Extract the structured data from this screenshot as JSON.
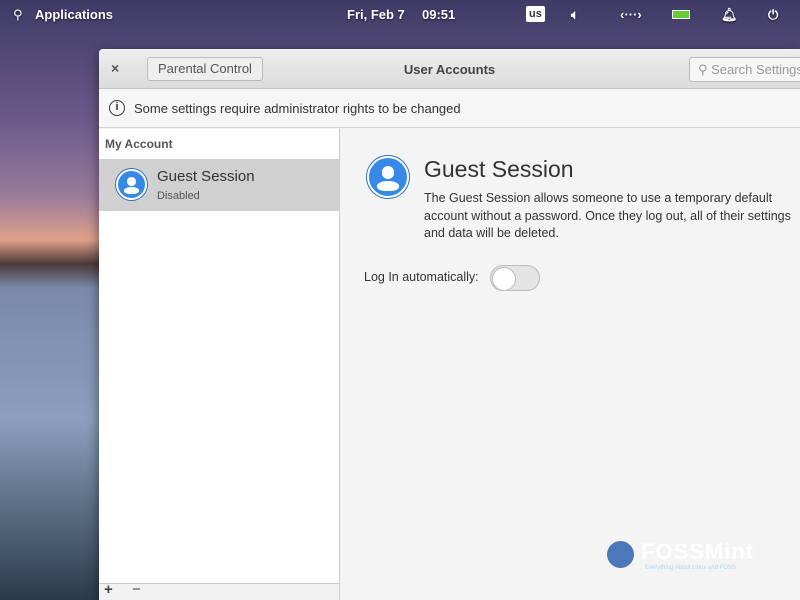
{
  "panel": {
    "applications": "Applications",
    "date": "Fri, Feb  7",
    "time": "09:51",
    "keyboard": "us",
    "icons": [
      "search-icon",
      "volume-icon",
      "network-icon",
      "battery-icon",
      "notification-bell-icon",
      "power-icon"
    ]
  },
  "window": {
    "title": "User Accounts",
    "back_label": "Parental Control",
    "search_placeholder": "Search Settings",
    "info": "Some settings require administrator rights to be changed"
  },
  "sidebar": {
    "section": "My Account",
    "items": [
      {
        "name": "Guest Session",
        "status": "Disabled"
      }
    ],
    "add": "+",
    "remove": "−"
  },
  "main": {
    "title": "Guest Session",
    "description": "The Guest Session allows someone to use a temporary default account without a password. Once they log out, all of their settings and data will be deleted.",
    "autologin_label": "Log In automatically:",
    "autologin_on": false
  },
  "watermark": {
    "name": "FOSSMint",
    "tagline": "Everything About Linux and FOSS"
  }
}
